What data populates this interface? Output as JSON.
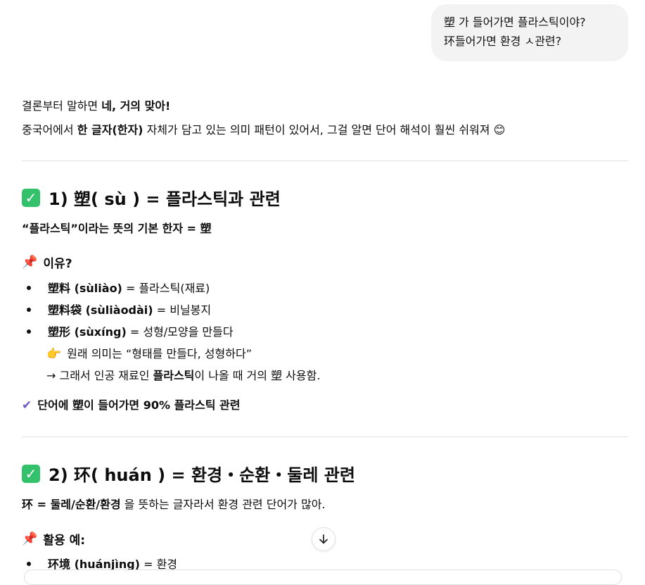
{
  "user_message": {
    "line1": "塑 가 들어가면 플라스틱이야?",
    "line2": "环들어가면 환경 ㅅ관련?"
  },
  "answer": {
    "intro1_pre": "결론부터 말하면 ",
    "intro1_bold": "네, 거의 맞아!",
    "intro2_pre": "중국어에서 ",
    "intro2_bold": "한 글자(한자)",
    "intro2_post": " 자체가 담고 있는 의미 패턴이 있어서, 그걸 알면 단어 해석이 훨씬 쉬워져 😊",
    "section1": {
      "title": "1) 塑( sù ) = 플라스틱과 관련",
      "subtitle": "“플라스틱”이라는 뜻의 기본 한자 = 塑",
      "reason_heading": "이유?",
      "items": [
        {
          "term": "塑料 (sùliào)",
          "meaning": " = 플라스틱(재료)"
        },
        {
          "term": "塑料袋 (sùliàodài)",
          "meaning": " = 비닐봉지"
        },
        {
          "term": "塑形 (sùxíng)",
          "meaning": " = 성형/모양을 만들다"
        }
      ],
      "note1": "원래 의미는 “형태를 만들다, 성형하다”",
      "note2_pre": "→ 그래서 인공 재료인 ",
      "note2_bold": "플라스틱",
      "note2_post": "이 나올 때 거의 塑 사용함.",
      "conclusion": "단어에 塑이 들어가면 90% 플라스틱 관련"
    },
    "section2": {
      "title": "2) 环( huán ) = 환경・순환・둘레 관련",
      "subtitle_pre": "环 = ",
      "subtitle_bold": "둘레/순환/환경",
      "subtitle_post": " 을 뜻하는 글자라서 환경 관련 단어가 많아.",
      "usage_heading": "활용 예:",
      "items": [
        {
          "term": "环境 (huánjìng)",
          "meaning": " = 환경"
        }
      ]
    }
  },
  "icons": {
    "check": "check-box-icon",
    "pin": "pushpin-icon",
    "point": "pointing-finger-icon",
    "tick": "check-mark-icon",
    "scroll": "arrow-down-icon"
  },
  "colors": {
    "bubble": "#f3f3f3",
    "check_green": "#33c26b",
    "pin_red": "#d63d3d",
    "tick_purple": "#6f57c9"
  }
}
